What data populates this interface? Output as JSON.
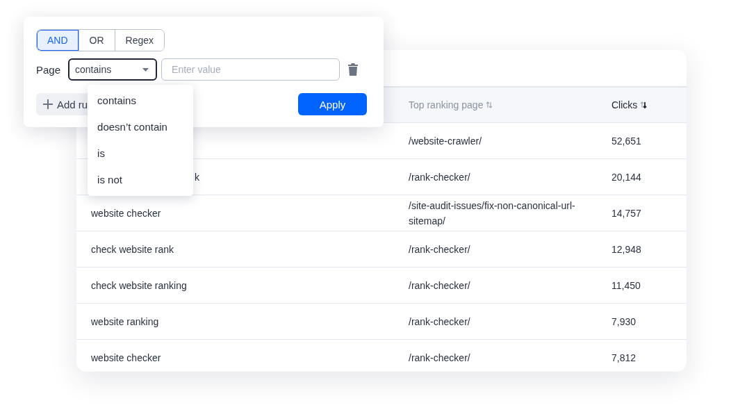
{
  "filter": {
    "modes": [
      {
        "label": "AND",
        "selected": true
      },
      {
        "label": "OR",
        "selected": false
      },
      {
        "label": "Regex",
        "selected": false
      }
    ],
    "field_label": "Page",
    "operator": "contains",
    "value_placeholder": "Enter value",
    "add_button": "Add ru",
    "apply_button": "Apply",
    "operator_menu": {
      "open": true,
      "options": [
        "contains",
        "doesn’t contain",
        "is",
        "is not"
      ]
    }
  },
  "table": {
    "columns": [
      {
        "label": "Top ranking page",
        "sorted": false
      },
      {
        "label": "Clicks",
        "sorted": true
      }
    ],
    "rows": [
      {
        "page": "/website-crawler/",
        "clicks": "52,651"
      },
      {
        "keyword": "k",
        "clipped": true,
        "page": "/rank-checker/",
        "clicks": "20,144"
      },
      {
        "keyword": "website checker",
        "page": "/site-audit-issues/fix-non-canonical-url-sitemap/",
        "clicks": "14,757"
      },
      {
        "keyword": "check website rank",
        "page": "/rank-checker/",
        "clicks": "12,948"
      },
      {
        "keyword": "check website ranking",
        "page": "/rank-checker/",
        "clicks": "11,450"
      },
      {
        "keyword": "website ranking",
        "page": "/rank-checker/",
        "clicks": "7,930"
      },
      {
        "keyword": "website checker",
        "page": "/rank-checker/",
        "clicks": "7,812"
      }
    ]
  }
}
